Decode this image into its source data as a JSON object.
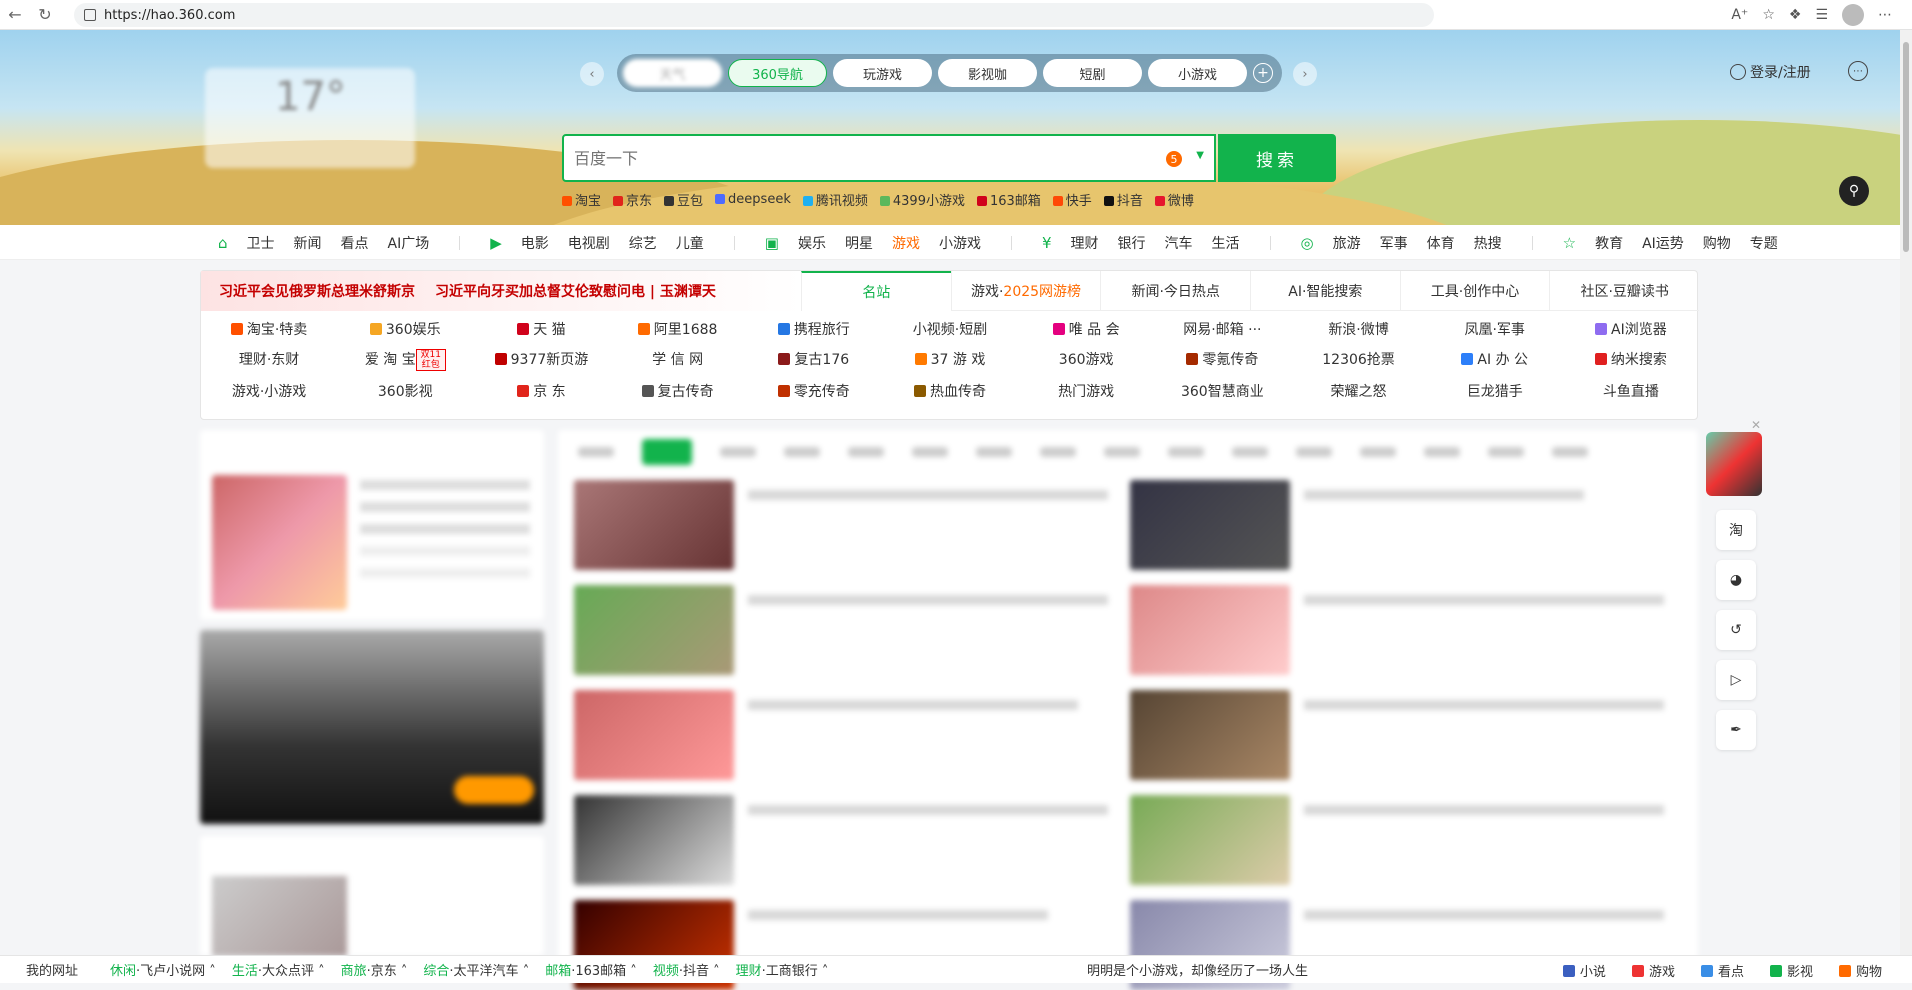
{
  "browser": {
    "url": "https://hao.360.com"
  },
  "tabs": [
    {
      "label": "天气"
    },
    {
      "label": "360导航"
    },
    {
      "label": "玩游戏"
    },
    {
      "label": "影视咖"
    },
    {
      "label": "短剧"
    },
    {
      "label": "小游戏"
    }
  ],
  "weather": {
    "temp": "17°"
  },
  "login": {
    "label": "登录/注册"
  },
  "search": {
    "placeholder": "百度一下",
    "badge": "5",
    "button": "搜索"
  },
  "quick_links": [
    {
      "label": "淘宝",
      "color": "#ff5000"
    },
    {
      "label": "京东",
      "color": "#e1251b"
    },
    {
      "label": "豆包",
      "color": "#333333"
    },
    {
      "label": "deepseek",
      "color": "#4d6bfe"
    },
    {
      "label": "腾讯视频",
      "color": "#20b0f0"
    },
    {
      "label": "4399小游戏",
      "color": "#5cb85c"
    },
    {
      "label": "163邮箱",
      "color": "#d0021b"
    },
    {
      "label": "快手",
      "color": "#ff4906"
    },
    {
      "label": "抖音",
      "color": "#111111"
    },
    {
      "label": "微博",
      "color": "#e6162d"
    }
  ],
  "catnav": [
    {
      "icon": "home-icon",
      "items": [
        "卫士",
        "新闻",
        "看点",
        "AI广场"
      ]
    },
    {
      "icon": "play-icon",
      "items": [
        "电影",
        "电视剧",
        "综艺",
        "儿童"
      ]
    },
    {
      "icon": "camera-icon",
      "items": [
        "娱乐",
        "明星",
        "游戏",
        "小游戏"
      ]
    },
    {
      "icon": "yen-icon",
      "items": [
        "理财",
        "银行",
        "汽车",
        "生活"
      ]
    },
    {
      "icon": "pin-icon",
      "items": [
        "旅游",
        "军事",
        "体育",
        "热搜"
      ]
    },
    {
      "icon": "star-icon",
      "items": [
        "教育",
        "AI运势",
        "购物",
        "专题"
      ]
    }
  ],
  "headlines": [
    "习近平会见俄罗斯总理米舒斯京",
    "习近平向牙买加总督艾伦致慰问电 | 玉渊谭天"
  ],
  "hot_tabs": [
    {
      "label": "名站"
    },
    {
      "label": "游戏·",
      "extra": "2025网游榜"
    },
    {
      "label": "新闻·今日热点"
    },
    {
      "label": "AI·智能搜索"
    },
    {
      "label": "工具·创作中心"
    },
    {
      "label": "社区·豆瓣读书"
    }
  ],
  "sites": [
    {
      "label": "淘宝·特卖",
      "color": "#ff5000"
    },
    {
      "label": "360娱乐",
      "color": "#f5a623"
    },
    {
      "label": "天 猫",
      "color": "#d0021b"
    },
    {
      "label": "阿里1688",
      "color": "#ff6a00"
    },
    {
      "label": "携程旅行",
      "color": "#2577e3"
    },
    {
      "label": "小视频·短剧",
      "color": ""
    },
    {
      "label": "唯 品 会",
      "color": "#e4007f"
    },
    {
      "label": "网易·邮箱 ···",
      "color": ""
    },
    {
      "label": "新浪·微博",
      "color": ""
    },
    {
      "label": "凤凰·军事",
      "color": ""
    },
    {
      "label": "AI浏览器",
      "color": "#8e6cf0"
    },
    {
      "label": "理财·东财",
      "color": ""
    },
    {
      "label": "爱 淘 宝",
      "color": "",
      "tag": "双11红包"
    },
    {
      "label": "9377新页游",
      "color": "#c00000"
    },
    {
      "label": "学 信 网",
      "color": ""
    },
    {
      "label": "复古176",
      "color": "#8b1a1a"
    },
    {
      "label": "37 游 戏",
      "color": "#ff7a00"
    },
    {
      "label": "360游戏",
      "color": ""
    },
    {
      "label": "零氪传奇",
      "color": "#a52a00"
    },
    {
      "label": "12306抢票",
      "color": ""
    },
    {
      "label": "AI 办 公",
      "color": "#2d7ff9"
    },
    {
      "label": "纳米搜索",
      "color": "#e02020"
    },
    {
      "label": "游戏·小游戏",
      "color": ""
    },
    {
      "label": "360影视",
      "color": ""
    },
    {
      "label": "京 东",
      "color": "#e1251b"
    },
    {
      "label": "复古传奇",
      "color": "#555555"
    },
    {
      "label": "零充传奇",
      "color": "#c03000"
    },
    {
      "label": "热血传奇",
      "color": "#8b5a00"
    },
    {
      "label": "热门游戏",
      "color": ""
    },
    {
      "label": "360智慧商业",
      "color": ""
    },
    {
      "label": "荣耀之怒",
      "color": ""
    },
    {
      "label": "巨龙猎手",
      "color": ""
    },
    {
      "label": "斗鱼直播",
      "color": ""
    }
  ],
  "rail": [
    {
      "label": "淘",
      "icon": "taobao-icon"
    },
    {
      "label": "◕",
      "icon": "eye-icon"
    },
    {
      "label": "↺",
      "icon": "refresh-icon"
    },
    {
      "label": "▷",
      "icon": "play-icon"
    },
    {
      "label": "✒",
      "icon": "feather-icon"
    }
  ],
  "bottom": {
    "my_sites": "我的网址",
    "items": [
      {
        "cat": "休闲",
        "name": "·飞卢小说网"
      },
      {
        "cat": "生活",
        "name": "·大众点评"
      },
      {
        "cat": "商旅",
        "name": "·京东"
      },
      {
        "cat": "综合",
        "name": "·太平洋汽车"
      },
      {
        "cat": "邮箱",
        "name": "·163邮箱"
      },
      {
        "cat": "视频",
        "name": "·抖音"
      },
      {
        "cat": "理财",
        "name": "·工商银行"
      }
    ],
    "slogan": "明明是个小游戏，却像经历了一场人生",
    "right": [
      {
        "label": "小说",
        "color": "#3b5fc0"
      },
      {
        "label": "游戏",
        "color": "#e33"
      },
      {
        "label": "看点",
        "color": "#3a8ee6"
      },
      {
        "label": "影视",
        "color": "#12b34c"
      },
      {
        "label": "购物",
        "color": "#ff6a00"
      }
    ]
  }
}
